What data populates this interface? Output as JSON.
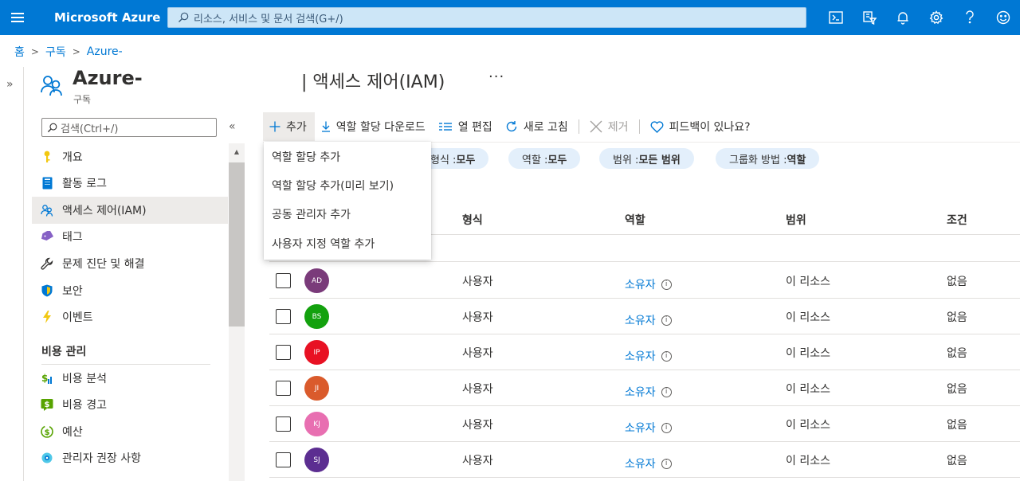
{
  "topbar": {
    "brand": "Microsoft Azure",
    "search_placeholder": "리소스, 서비스 및 문서 검색(G+/)",
    "icons": [
      "cloud-shell-icon",
      "directory-filter-icon",
      "notifications-icon",
      "settings-icon",
      "help-icon",
      "feedback-icon"
    ]
  },
  "breadcrumb": [
    "홈",
    "구독",
    "Azure-"
  ],
  "resource": {
    "name": "Azure-",
    "type": "구독",
    "page_title": "| 액세스 제어(IAM)",
    "more": "···"
  },
  "sidebar": {
    "search_placeholder": "검색(Ctrl+/)",
    "collapse": "«",
    "items": [
      {
        "label": "개요",
        "icon": "key-icon",
        "color": "#f2c811"
      },
      {
        "label": "활동 로그",
        "icon": "activity-log-icon",
        "color": "#0078d4"
      },
      {
        "label": "액세스 제어(IAM)",
        "icon": "iam-users-icon",
        "color": "#0078d4",
        "active": true
      },
      {
        "label": "태그",
        "icon": "tag-icon",
        "color": "#8661c5"
      },
      {
        "label": "문제 진단 및 해결",
        "icon": "wrench-icon",
        "color": "#605e5c"
      },
      {
        "label": "보안",
        "icon": "shield-icon",
        "color": "#0078d4"
      },
      {
        "label": "이벤트",
        "icon": "lightning-icon",
        "color": "#f2c811"
      }
    ],
    "section": "비용 관리",
    "section_items": [
      {
        "label": "비용 분석",
        "icon": "cost-analysis-icon",
        "color": "#57a300"
      },
      {
        "label": "비용 경고",
        "icon": "cost-alert-icon",
        "color": "#57a300"
      },
      {
        "label": "예산",
        "icon": "budget-icon",
        "color": "#57a300"
      },
      {
        "label": "관리자 권장 사항",
        "icon": "advisor-icon",
        "color": "#0078d4"
      }
    ]
  },
  "toolbar": {
    "add": "추가",
    "download": "역할 할당 다운로드",
    "edit_columns": "열 편집",
    "refresh": "새로 고침",
    "remove": "제거",
    "feedback": "피드백이 있나요?"
  },
  "dropdown": {
    "items": [
      "역할 할당 추가",
      "역할 할당 추가(미리 보기)",
      "공동 관리자 추가",
      "사용자 지정 역할 추가"
    ]
  },
  "filters": [
    {
      "label": "형식 : ",
      "value": "모두"
    },
    {
      "label": "역할 : ",
      "value": "모두"
    },
    {
      "label": "범위 : ",
      "value": "모든 범위"
    },
    {
      "label": "그룹화 방법 : ",
      "value": "역할"
    }
  ],
  "table": {
    "columns": [
      "형식",
      "역할",
      "범위",
      "조건"
    ],
    "rows": [
      {
        "initials": "AD",
        "color": "#7a3b7a",
        "type": "사용자",
        "role": "소유자",
        "scope": "이 리소스",
        "condition": "없음"
      },
      {
        "initials": "BS",
        "color": "#13a10e",
        "type": "사용자",
        "role": "소유자",
        "scope": "이 리소스",
        "condition": "없음"
      },
      {
        "initials": "IP",
        "color": "#e81123",
        "type": "사용자",
        "role": "소유자",
        "scope": "이 리소스",
        "condition": "없음"
      },
      {
        "initials": "JI",
        "color": "#da5b2c",
        "type": "사용자",
        "role": "소유자",
        "scope": "이 리소스",
        "condition": "없음"
      },
      {
        "initials": "KJ",
        "color": "#e86fb1",
        "type": "사용자",
        "role": "소유자",
        "scope": "이 리소스",
        "condition": "없음"
      },
      {
        "initials": "SJ",
        "color": "#5c2e91",
        "type": "사용자",
        "role": "소유자",
        "scope": "이 리소스",
        "condition": "없음"
      }
    ]
  }
}
